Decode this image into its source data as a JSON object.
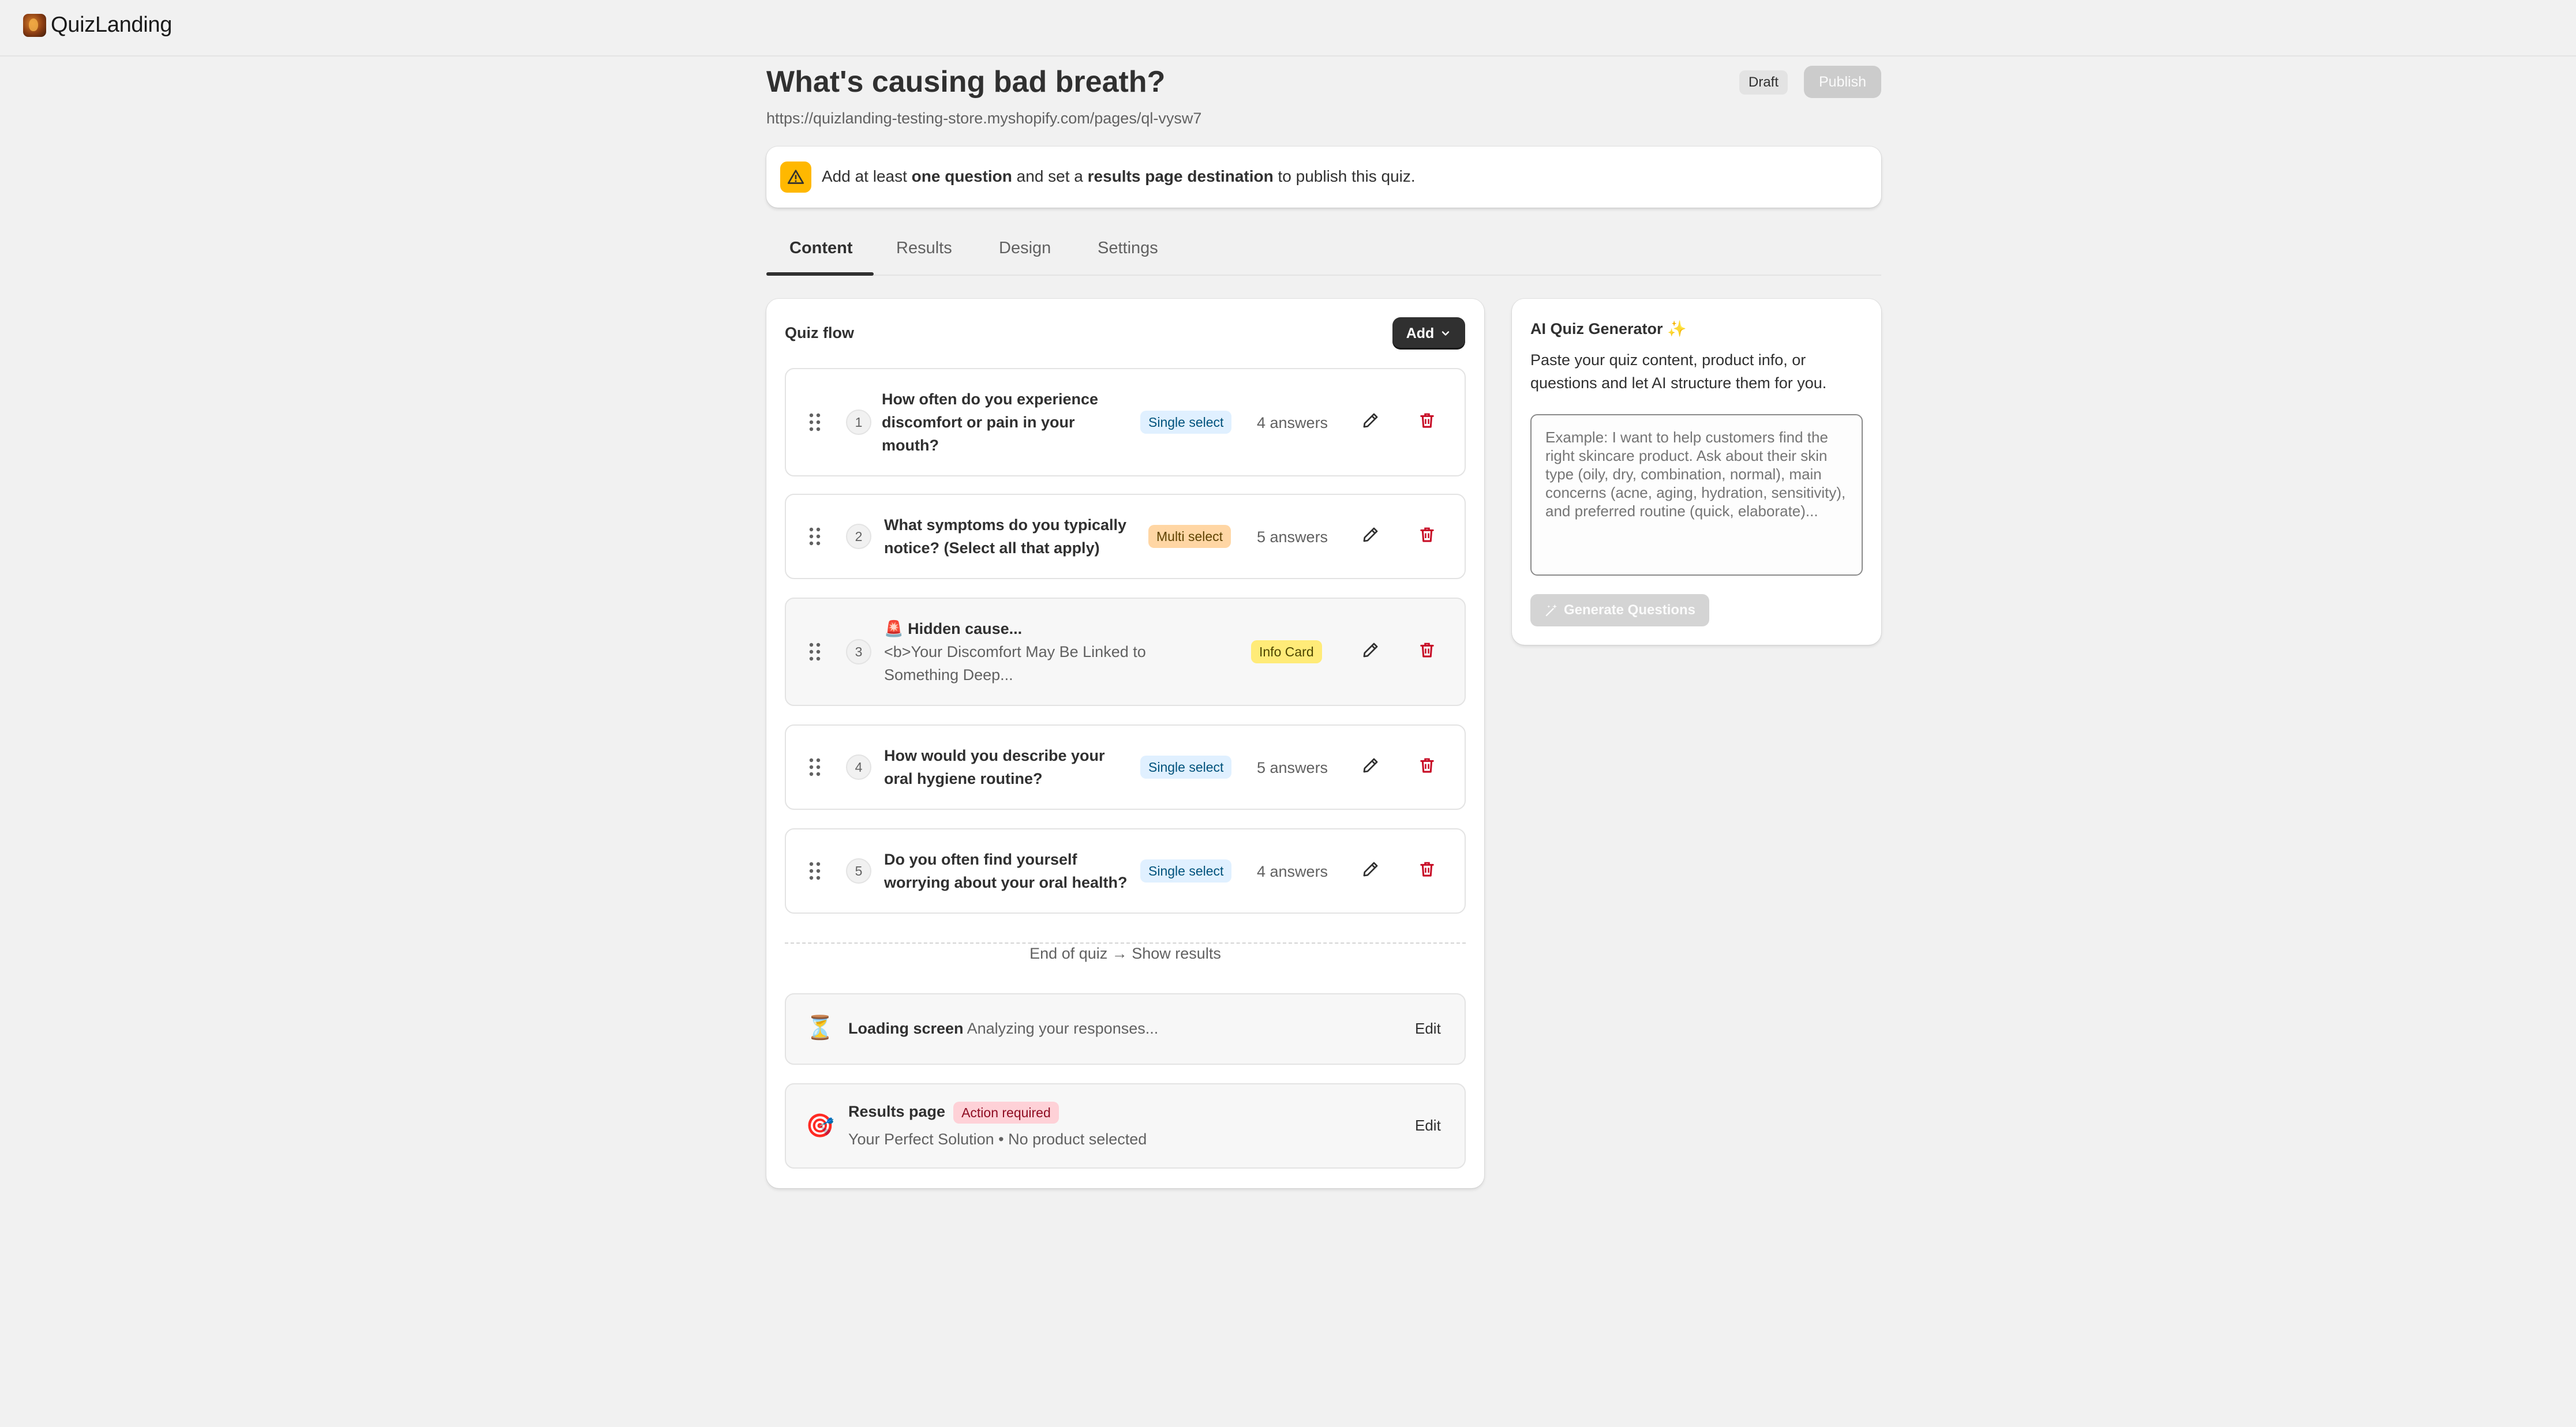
{
  "app": {
    "name": "QuizLanding"
  },
  "header": {
    "title": "What's causing bad breath?",
    "url": "https://quizlanding-testing-store.myshopify.com/pages/ql-vysw7",
    "status_badge": "Draft",
    "publish_label": "Publish"
  },
  "banner": {
    "part1": "Add at least ",
    "bold1": "one question",
    "part2": " and set a ",
    "bold2": "results page destination",
    "part3": " to publish this quiz."
  },
  "tabs": [
    "Content",
    "Results",
    "Design",
    "Settings"
  ],
  "flow": {
    "title": "Quiz flow",
    "add_label": "Add",
    "questions": [
      {
        "num": "1",
        "text": "How often do you experience discomfort or pain in your mouth?",
        "type": "Single select",
        "answers": "4 answers"
      },
      {
        "num": "2",
        "text": "What symptoms do you typically notice? (Select all that apply)",
        "type": "Multi select",
        "answers": "5 answers"
      },
      {
        "num": "3",
        "text": "🚨 Hidden cause...",
        "subtext": "<b>Your Discomfort May Be Linked to Something Deep...",
        "type": "Info Card",
        "answers": ""
      },
      {
        "num": "4",
        "text": "How would you describe your oral hygiene routine?",
        "type": "Single select",
        "answers": "5 answers"
      },
      {
        "num": "5",
        "text": "Do you often find yourself worrying about your oral health?",
        "type": "Single select",
        "answers": "4 answers"
      }
    ],
    "end_text": "End of quiz → Show results",
    "loading": {
      "icon": "⏳",
      "title": "Loading screen",
      "subtitle": "Analyzing your responses...",
      "edit_label": "Edit"
    },
    "results": {
      "icon": "🎯",
      "title": "Results page",
      "badge": "Action required",
      "subtitle": "Your Perfect Solution • No product selected",
      "edit_label": "Edit"
    }
  },
  "ai": {
    "title": "AI Quiz Generator ✨",
    "description": "Paste your quiz content, product info, or questions and let AI structure them for you.",
    "placeholder": "Example: I want to help customers find the right skincare product. Ask about their skin type (oily, dry, combination, normal), main concerns (acne, aging, hydration, sensitivity), and preferred routine (quick, elaborate)...",
    "generate_label": "Generate Questions"
  }
}
